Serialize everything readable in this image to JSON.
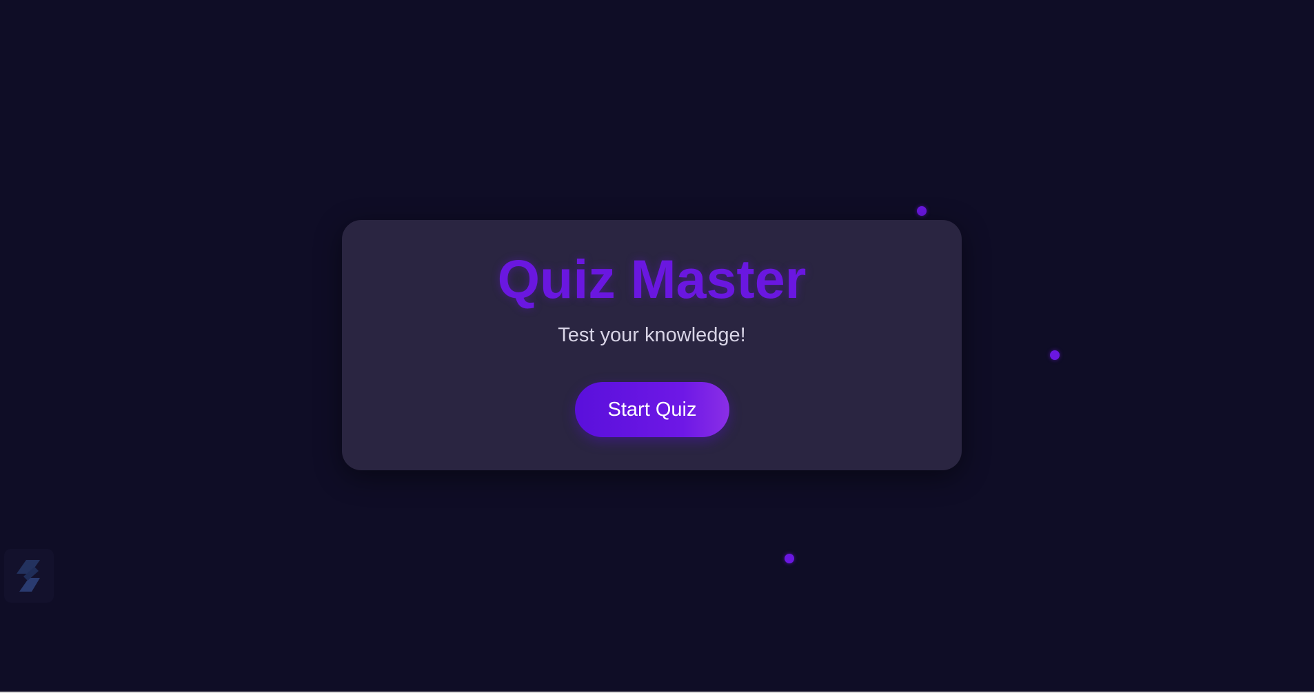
{
  "card": {
    "title": "Quiz Master",
    "subtitle": "Test your knowledge!",
    "start_button_label": "Start Quiz"
  },
  "decor": {
    "particles": [
      "particle-dot",
      "particle-dot",
      "particle-dot"
    ],
    "corner_icon": "app-logo-icon"
  },
  "colors": {
    "background": "#0f0d26",
    "card": "#2a2541",
    "accent": "#6a17e0",
    "button_gradient_start": "#5a10db",
    "button_gradient_end": "#8a2fe6"
  }
}
